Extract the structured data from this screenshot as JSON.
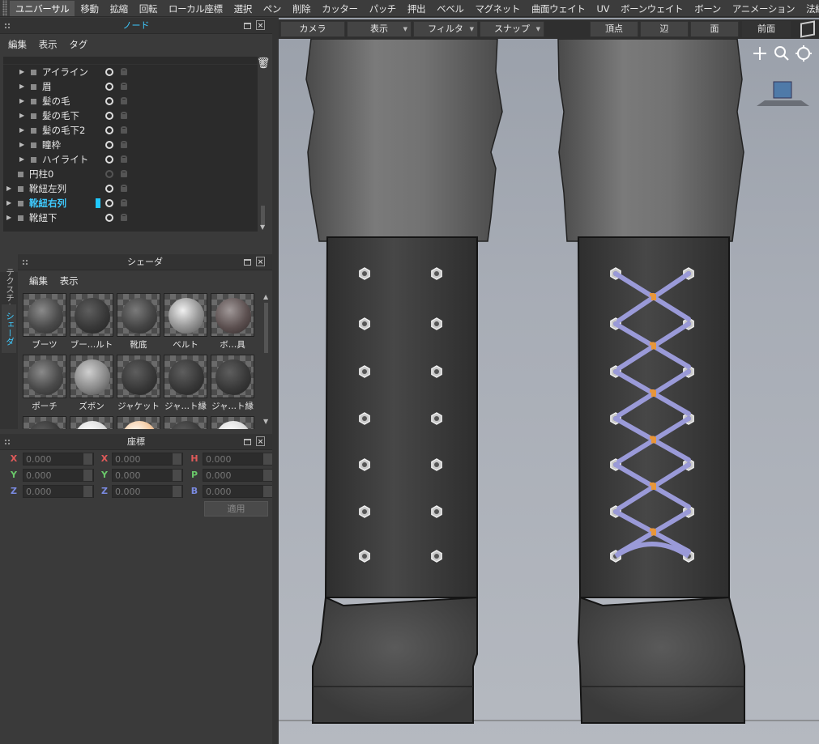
{
  "menubar": {
    "items": [
      "ユニバーサル",
      "移動",
      "拡縮",
      "回転",
      "ローカル座標",
      "選択",
      "ペン",
      "削除",
      "カッター",
      "パッチ",
      "押出",
      "ベベル",
      "マグネット",
      "曲面ウェイト",
      "UV",
      "ボーンウェイト",
      "ボーン",
      "アニメーション",
      "法線"
    ],
    "active_index": 0
  },
  "node_panel": {
    "title": "ノード",
    "menu": [
      "編集",
      "表示",
      "タグ"
    ],
    "toolbar_icons": [
      "chevron-up-icon",
      "chevron-down-icon",
      "refresh-icon",
      "hierarchy-icon",
      "grid-icon",
      "group-icon",
      "cube-icon",
      "trash-icon"
    ],
    "tree": [
      {
        "name": "アイライン",
        "indent": 2,
        "expandable": true,
        "visible": true
      },
      {
        "name": "眉",
        "indent": 2,
        "expandable": true,
        "visible": true
      },
      {
        "name": "髪の毛",
        "indent": 2,
        "expandable": true,
        "visible": true
      },
      {
        "name": "髪の毛下",
        "indent": 2,
        "expandable": true,
        "visible": true
      },
      {
        "name": "髪の毛下2",
        "indent": 2,
        "expandable": true,
        "visible": true
      },
      {
        "name": "瞳枠",
        "indent": 2,
        "expandable": true,
        "visible": true
      },
      {
        "name": "ハイライト",
        "indent": 2,
        "expandable": true,
        "visible": true
      },
      {
        "name": "円柱0",
        "indent": 1,
        "expandable": false,
        "visible": false
      },
      {
        "name": "靴紐左列",
        "indent": 1,
        "expandable": true,
        "visible": true
      },
      {
        "name": "靴紐右列",
        "indent": 1,
        "expandable": true,
        "visible": true,
        "selected": true
      },
      {
        "name": "靴紐下",
        "indent": 1,
        "expandable": true,
        "visible": true
      }
    ]
  },
  "shader_panel": {
    "title": "シェーダ",
    "menu": [
      "編集",
      "表示"
    ],
    "side_tabs": [
      "テクスチャ",
      "シェーダ"
    ],
    "active_tab": "シェーダ",
    "materials": [
      {
        "name": "ブーツ",
        "tone": "dark"
      },
      {
        "name": "ブー…ルト",
        "tone": "darker"
      },
      {
        "name": "靴底",
        "tone": "mid"
      },
      {
        "name": "ベルト",
        "tone": "light"
      },
      {
        "name": "ボ…具",
        "tone": "brownish"
      },
      {
        "name": "ポーチ",
        "tone": "dark"
      },
      {
        "name": "ズボン",
        "tone": "light2"
      },
      {
        "name": "ジャケット",
        "tone": "darker"
      },
      {
        "name": "ジャ…ト縁",
        "tone": "darker"
      },
      {
        "name": "ジャ…ト縁",
        "tone": "darker"
      },
      {
        "name": "",
        "tone": "darker"
      },
      {
        "name": "",
        "tone": "white"
      },
      {
        "name": "",
        "tone": "peach"
      },
      {
        "name": "",
        "tone": "darker"
      },
      {
        "name": "",
        "tone": "white"
      }
    ]
  },
  "coord_panel": {
    "title": "座標",
    "col1": [
      {
        "axis": "X",
        "value": "0.000"
      },
      {
        "axis": "Y",
        "value": "0.000"
      },
      {
        "axis": "Z",
        "value": "0.000"
      }
    ],
    "col2": [
      {
        "axis": "X",
        "value": "0.000"
      },
      {
        "axis": "Y",
        "value": "0.000"
      },
      {
        "axis": "Z",
        "value": "0.000"
      }
    ],
    "col3": [
      {
        "axis": "H",
        "value": "0.000"
      },
      {
        "axis": "P",
        "value": "0.000"
      },
      {
        "axis": "B",
        "value": "0.000"
      }
    ],
    "apply_label": "適用"
  },
  "viewport": {
    "toolbar": {
      "camera": "カメラ",
      "display": "表示",
      "filter": "フィルタ",
      "snap": "スナップ",
      "vertex": "頂点",
      "edge": "辺",
      "face": "面",
      "view": "前面"
    },
    "nav_icons": [
      "move-icon",
      "zoom-icon",
      "rotate-icon"
    ],
    "colors": {
      "background": "#a3a8b1",
      "boot": "#3e3e3e",
      "lace": "#9a9ad8",
      "tip": "#e8963a"
    }
  }
}
